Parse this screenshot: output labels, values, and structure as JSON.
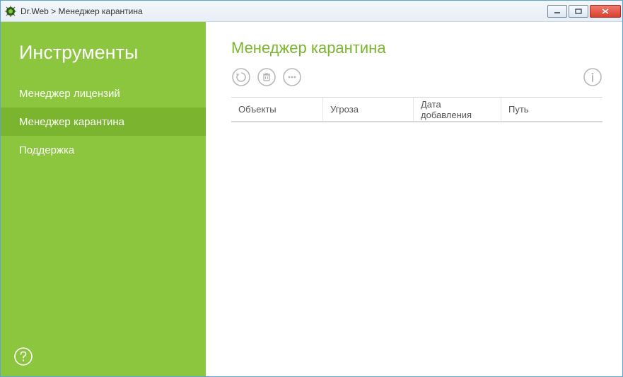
{
  "window": {
    "title": "Dr.Web > Менеджер карантина"
  },
  "sidebar": {
    "title": "Инструменты",
    "items": [
      {
        "label": "Менеджер лицензий",
        "name": "sidebar-item-license-manager",
        "active": false
      },
      {
        "label": "Менеджер карантина",
        "name": "sidebar-item-quarantine-manager",
        "active": true
      },
      {
        "label": "Поддержка",
        "name": "sidebar-item-support",
        "active": false
      }
    ]
  },
  "main": {
    "title": "Менеджер карантина",
    "toolbar": {
      "restore_icon": "restore-icon",
      "delete_icon": "trash-icon",
      "more_icon": "more-icon",
      "info_icon": "info-icon"
    },
    "table": {
      "columns": [
        {
          "label": "Объекты"
        },
        {
          "label": "Угроза"
        },
        {
          "label": "Дата добавления"
        },
        {
          "label": "Путь"
        }
      ],
      "rows": []
    }
  },
  "colors": {
    "accent": "#8cc63f",
    "accent_dark": "#7bb52f",
    "icon_gray": "#b8b8b8"
  }
}
